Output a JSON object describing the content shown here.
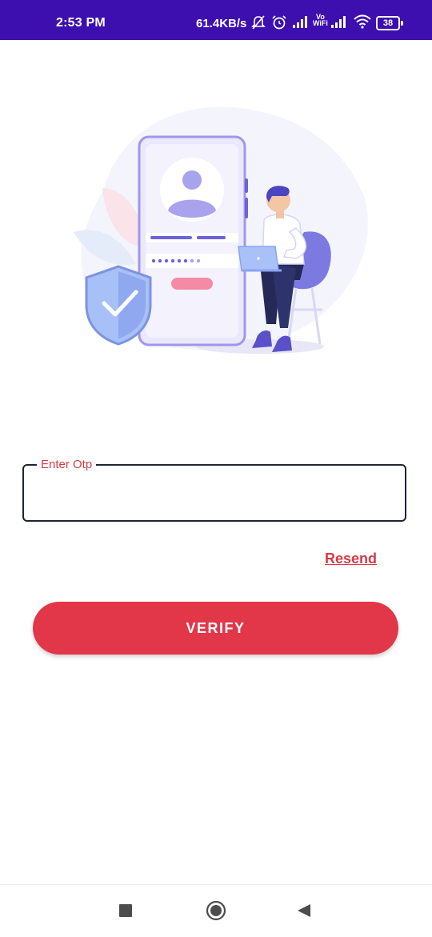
{
  "status_bar": {
    "time": "2:53 PM",
    "network_speed": "61.4KB/s",
    "vowifi_label_top": "Vo",
    "vowifi_label_bottom": "WiFi",
    "battery_level": "38",
    "icons": [
      "mute-icon",
      "alarm-icon",
      "signal-icon",
      "vowifi-icon",
      "signal-icon",
      "wifi-icon",
      "battery-icon"
    ]
  },
  "illustration": {
    "icons": [
      "phone-login-illustration",
      "avatar-icon",
      "shield-check-icon",
      "person-with-laptop"
    ],
    "colors": {
      "primary": "#6c63d9",
      "light": "#e9e7fb",
      "accent": "#f48aa6"
    }
  },
  "otp": {
    "label": "Enter Otp",
    "value": "",
    "placeholder": ""
  },
  "resend_label": "Resend",
  "verify_label": "VERIFY",
  "colors": {
    "status_bar": "#3d0fae",
    "accent": "#e13748",
    "label": "#d83b47",
    "field_border": "#1d2433"
  },
  "nav_bar": {
    "icons": [
      "recents-square-icon",
      "home-circle-icon",
      "back-triangle-icon"
    ]
  }
}
